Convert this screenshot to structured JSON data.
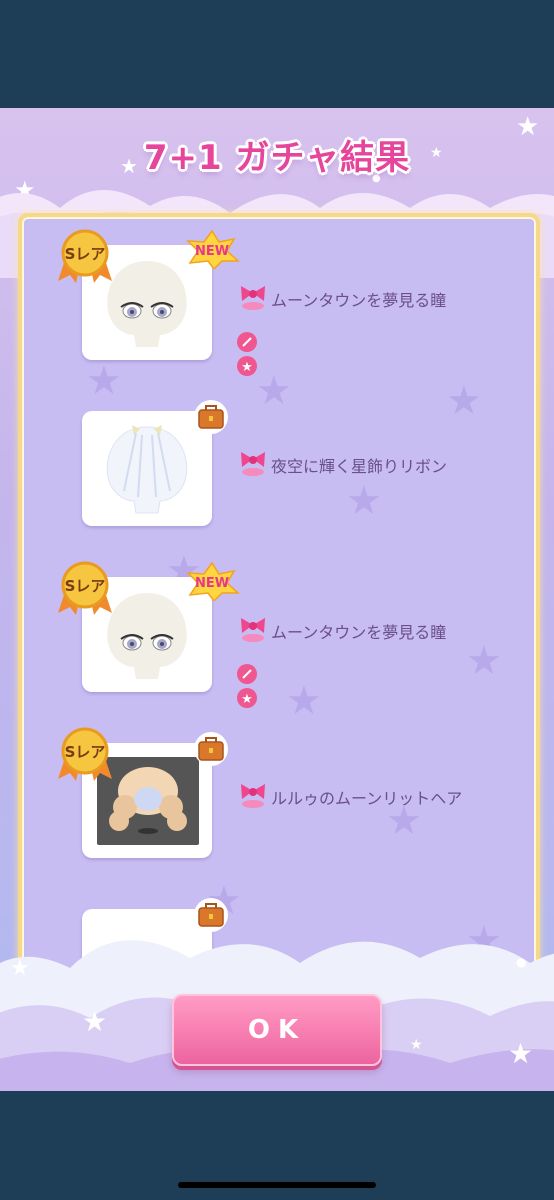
{
  "title": "7+1 ガチャ結果",
  "ok_label": "OK",
  "badges": {
    "rare": "Sレア",
    "new": "NEW"
  },
  "results": [
    {
      "name": "ムーンタウンを夢見る瞳",
      "rare": true,
      "new": true,
      "type": "eyes"
    },
    {
      "name": "夜空に輝く星飾りリボン",
      "rare": false,
      "new": false,
      "type": "ribbon"
    },
    {
      "name": "ムーンタウンを夢見る瞳",
      "rare": true,
      "new": true,
      "type": "eyes"
    },
    {
      "name": "ルルゥのムーンリットヘア",
      "rare": true,
      "new": false,
      "type": "hair"
    },
    {
      "name": "",
      "rare": false,
      "new": false,
      "type": "ribbon"
    }
  ],
  "colors": {
    "title": "#e6459c",
    "ok_button": "#f77db0",
    "frame": "#f6d88a",
    "item_text": "#6b4f8a"
  }
}
